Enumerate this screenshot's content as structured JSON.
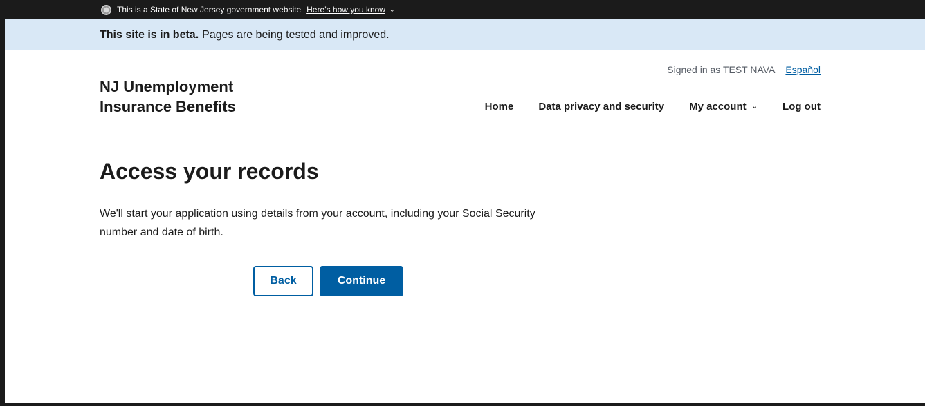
{
  "gov_banner": {
    "seal_icon": "nj-seal-icon",
    "text": "This is a State of New Jersey government website",
    "link": "Here’s how you know",
    "chevron": "⌄"
  },
  "beta_banner": {
    "strong": "This site is in beta.",
    "text": "Pages are being tested and improved."
  },
  "header": {
    "site_title": "NJ Unemployment Insurance Benefits",
    "signed_in": "Signed in as TEST NAVA",
    "language_link": "Español",
    "nav": {
      "home": "Home",
      "privacy": "Data privacy and security",
      "account": "My account",
      "account_chevron": "⌄",
      "logout": "Log out"
    }
  },
  "main": {
    "title": "Access your records",
    "intro": "We'll start your application using details from your account, including your Social Security number and date of birth.",
    "back_label": "Back",
    "continue_label": "Continue"
  },
  "colors": {
    "primary": "#005ea2",
    "beta_bg": "#d9e8f6",
    "gov_bg": "#1b1b1b"
  }
}
